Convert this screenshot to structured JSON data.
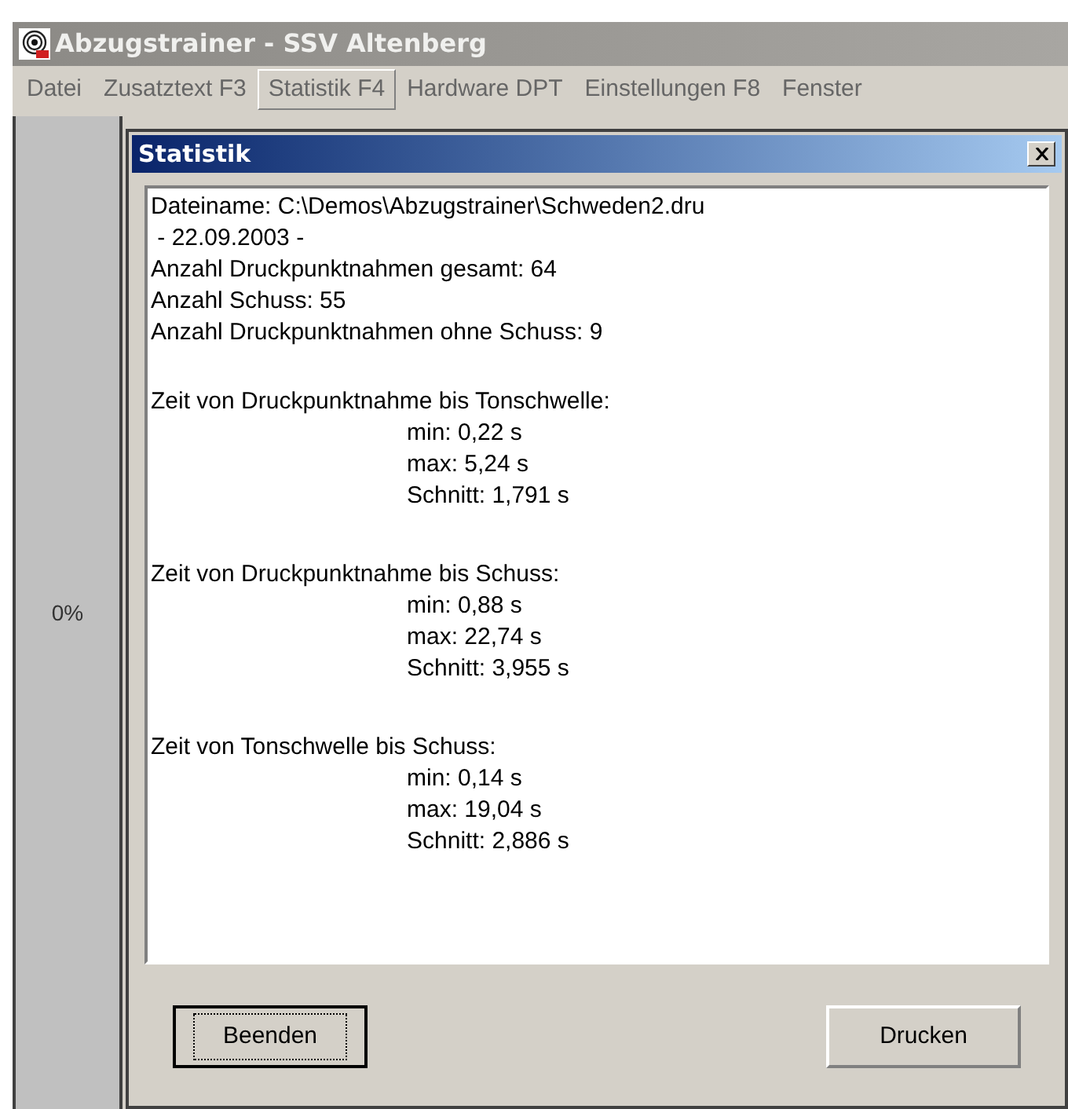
{
  "window": {
    "title": "Abzugstrainer - SSV Altenberg"
  },
  "menu": [
    {
      "label": "Datei",
      "selected": false
    },
    {
      "label": "Zusatztext F3",
      "selected": false
    },
    {
      "label": "Statistik F4",
      "selected": true
    },
    {
      "label": "Hardware DPT",
      "selected": false
    },
    {
      "label": "Einstellungen F8",
      "selected": false
    },
    {
      "label": "Fenster",
      "selected": false
    }
  ],
  "side_panel": {
    "percent": "0%"
  },
  "dialog": {
    "title": "Statistik",
    "header_lines": [
      "Dateiname: C:\\Demos\\Abzugstrainer\\Schweden2.dru",
      " - 22.09.2003 -",
      "Anzahl Druckpunktnahmen gesamt: 64",
      "Anzahl Schuss: 55",
      "Anzahl Druckpunktnahmen ohne Schuss: 9"
    ],
    "sections": [
      {
        "title": "Zeit von Druckpunktnahme bis Tonschwelle:",
        "lines": [
          "min: 0,22 s",
          "max: 5,24 s",
          "Schnitt: 1,791 s"
        ]
      },
      {
        "title": "Zeit von Druckpunktnahme bis Schuss:",
        "lines": [
          "min: 0,88 s",
          "max: 22,74 s",
          "Schnitt: 3,955 s"
        ]
      },
      {
        "title": "Zeit von Tonschwelle bis Schuss:",
        "lines": [
          "min: 0,14 s",
          "max: 19,04 s",
          "Schnitt: 2,886 s"
        ]
      }
    ],
    "buttons": [
      {
        "label": "Beenden",
        "focused": true
      },
      {
        "label": "Drucken",
        "focused": false
      }
    ]
  }
}
